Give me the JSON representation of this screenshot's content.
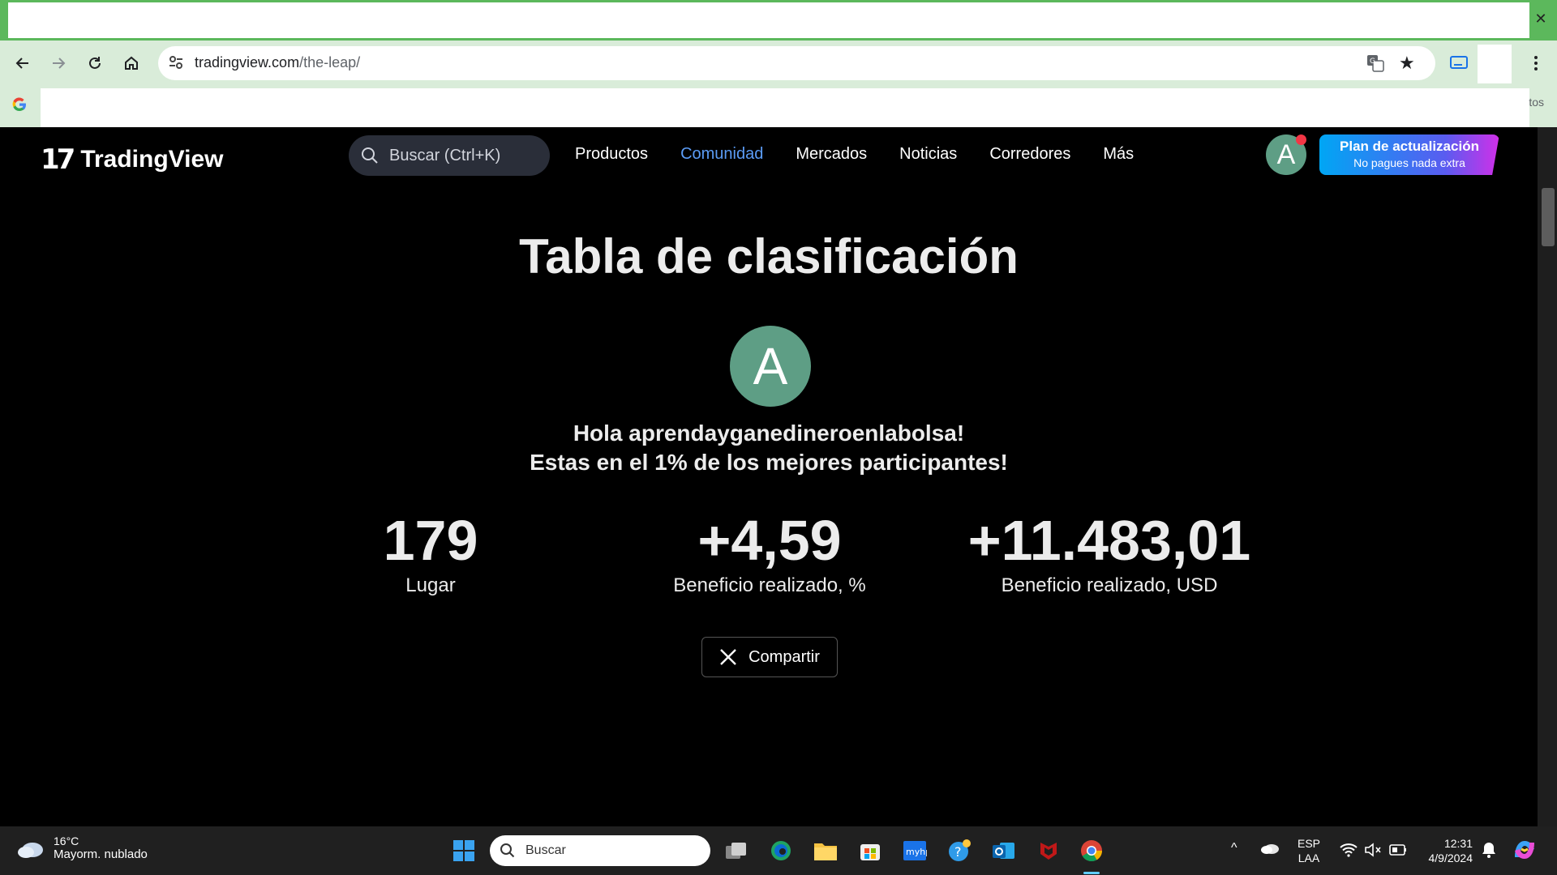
{
  "browser": {
    "url_domain": "tradingview.com",
    "url_path": "/the-leap/",
    "bookmarks_overflow": "tos"
  },
  "site": {
    "logo_mark": "17",
    "logo_text": "TradingView",
    "search_placeholder": "Buscar (Ctrl+K)",
    "nav": [
      {
        "label": "Productos",
        "active": false
      },
      {
        "label": "Comunidad",
        "active": true
      },
      {
        "label": "Mercados",
        "active": false
      },
      {
        "label": "Noticias",
        "active": false
      },
      {
        "label": "Corredores",
        "active": false
      },
      {
        "label": "Más",
        "active": false
      }
    ],
    "avatar_letter": "A",
    "upgrade_title": "Plan de actualización",
    "upgrade_subtitle": "No pagues nada extra"
  },
  "leaderboard": {
    "heading": "Tabla de clasificación",
    "avatar_letter": "A",
    "greeting_line1": "Hola aprendayganedineroenlabolsa!",
    "greeting_line2": "Estas en el 1% de los mejores participantes!",
    "stats": [
      {
        "value": "179",
        "label": "Lugar"
      },
      {
        "value": "+4,59",
        "label": "Beneficio realizado, %"
      },
      {
        "value": "+11.483,01",
        "label": "Beneficio realizado, USD"
      }
    ],
    "share_label": "Compartir"
  },
  "taskbar": {
    "weather_temp": "16°C",
    "weather_desc": "Mayorm. nublado",
    "search_placeholder": "Buscar",
    "lang_line1": "ESP",
    "lang_line2": "LAA",
    "time": "12:31",
    "date": "4/9/2024"
  },
  "colors": {
    "accent_blue": "#5b9cf6",
    "avatar_green": "#5e9e85",
    "notification_red": "#f23645",
    "chrome_frame_green": "#5cb85c"
  }
}
